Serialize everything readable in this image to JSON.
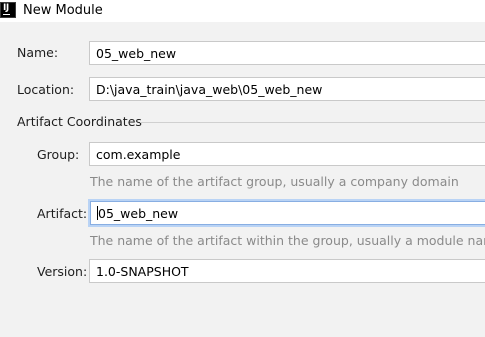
{
  "window": {
    "title": "New Module",
    "icon": "intellij-idea-icon",
    "icon_letters": "IJ"
  },
  "form": {
    "name": {
      "label": "Name:",
      "value": "05_web_new"
    },
    "location": {
      "label": "Location:",
      "value": "D:\\java_train\\java_web\\05_web_new"
    },
    "artifact_coordinates": {
      "title": "Artifact Coordinates",
      "group": {
        "label": "Group:",
        "value": "com.example",
        "hint": "The name of the artifact group, usually a company domain"
      },
      "artifact": {
        "label": "Artifact:",
        "value": "05_web_new",
        "hint": "The name of the artifact within the group, usually a module name"
      },
      "version": {
        "label": "Version:",
        "value": "1.0-SNAPSHOT"
      }
    }
  },
  "colors": {
    "background": "#f2f2f2",
    "field_border": "#c9c9c9",
    "focus_ring": "#b9d3f5",
    "hint_text": "#8a8a8a"
  }
}
